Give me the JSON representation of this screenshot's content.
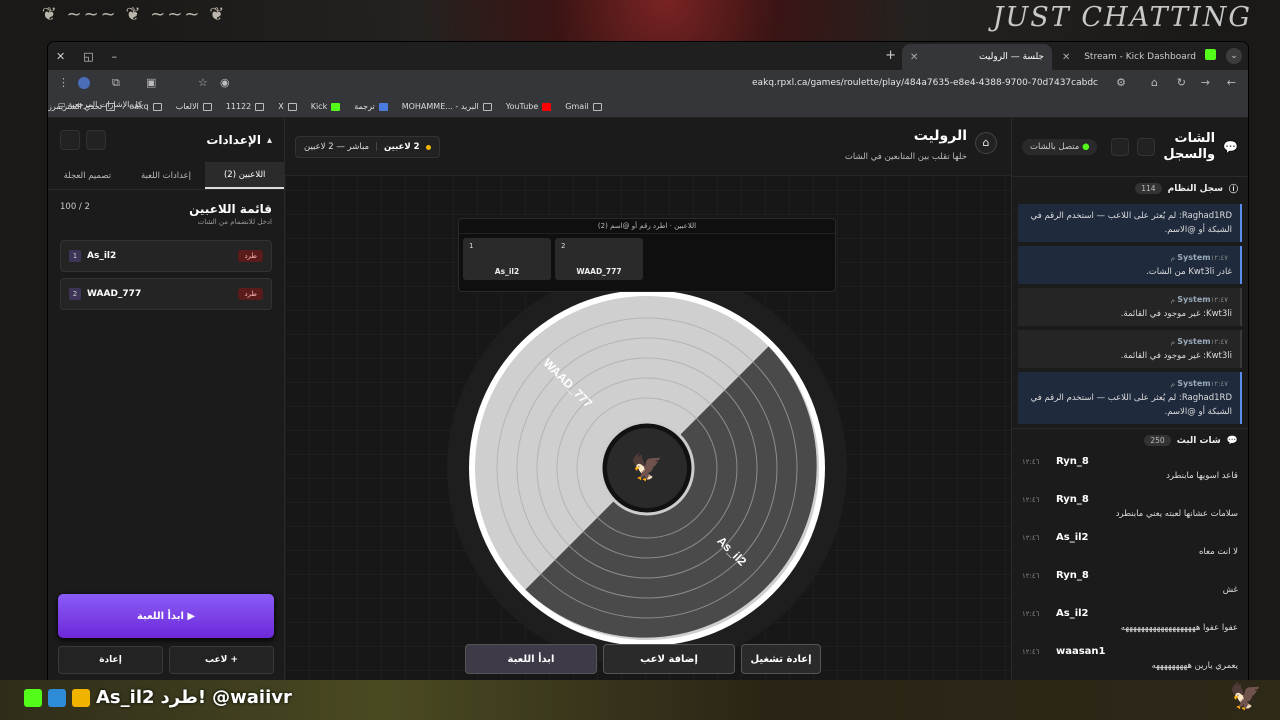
{
  "colors": {
    "accent": "#7c3aed",
    "kick_green": "#53fc18",
    "danger": "#5a1b1b"
  },
  "stream": {
    "brand": "JUST CHATTING",
    "overlay_user": "As_il2",
    "overlay_cmd": "طرد!",
    "overlay_by": "@waiivr"
  },
  "browser": {
    "tabs": [
      {
        "label": "جلسة — الروليت",
        "active": true
      },
      {
        "label": "Stream - Kick Dashboard",
        "active": false
      }
    ],
    "url": "eakq.rpxl.ca/games/roulette/play/484a7635-e8e4-4388-9700-70d7437cabdc",
    "bookmarks": [
      "Gmail",
      "YouTube",
      "البريد - ...MOHAMME",
      "ترجمة",
      "Kick",
      "X",
      "11122",
      "الالعاب",
      "eakq",
      "تحدي الستريمرز"
    ],
    "all_bookmarks": "كل الإشارات المرجعية"
  },
  "settings": {
    "title": "الإعدادات",
    "tabs": [
      "اللاعبين (2)",
      "إعدادات اللعبة",
      "تصميم العجلة"
    ],
    "list_title": "قائمة اللاعبين",
    "list_count": "2 / 100",
    "list_hint": "ادخل للانضمام من الشات",
    "players": [
      {
        "num": "1",
        "name": "As_il2",
        "kick": "طرد"
      },
      {
        "num": "2",
        "name": "WAAD_777",
        "kick": "طرد"
      }
    ],
    "start_label": "▶ ابدأ اللعبة",
    "add_label": "+ لاعب",
    "reset_label": "إعادة"
  },
  "center": {
    "title": "الروليت",
    "subtitle": "خلها تقلب بين المتابعين في الشات",
    "live_count": "2 لاعبين",
    "live_status": "مباشر — 2 لاعبين",
    "picker_hint": "اللاعبين · اطرد رقم أو @اسم (2)",
    "picker_cards": [
      {
        "num": "1",
        "name": "As_il2"
      },
      {
        "num": "2",
        "name": "WAAD_777"
      }
    ],
    "wheel_labels": [
      "WAAD_777",
      "As_il2"
    ],
    "btn_restart": "إعادة تشغيل",
    "btn_add": "إضافة لاعب",
    "btn_start": "ابدأ اللعبة"
  },
  "chat": {
    "title1": "الشات",
    "title2": "والسجل",
    "status": "متصل بالشات",
    "syslog_title": "سجل النظام",
    "syslog_count": "114",
    "sys": [
      {
        "who": "",
        "time": "",
        "text": "Raghad1RD: لم يُعثر على اللاعب — استخدم الرقم في الشبكة أو @الاسم.",
        "blue": true
      },
      {
        "who": "System",
        "time": "١٢:٤٧ م",
        "text": "غادر Kwt3li من الشات.",
        "blue": true
      },
      {
        "who": "System",
        "time": "١٢:٤٧ م",
        "text": "Kwt3li: غير موجود في القائمة.",
        "blue": false
      },
      {
        "who": "System",
        "time": "١٢:٤٧ م",
        "text": "Kwt3li: غير موجود في القائمة.",
        "blue": false
      },
      {
        "who": "System",
        "time": "١٢:٤٧ م",
        "text": "Raghad1RD: لم يُعثر على اللاعب — استخدم الرقم في الشبكة أو @الاسم.",
        "blue": true
      }
    ],
    "chat_title": "شات البث",
    "chat_count": "250",
    "msgs": [
      {
        "user": "Ryn_8",
        "time": "١٢:٤٦",
        "text": "قاعد اسويها مابنطرد"
      },
      {
        "user": "Ryn_8",
        "time": "١٢:٤٦",
        "text": "سلامات عشانها لعبته يعني مابنطرد"
      },
      {
        "user": "As_il2",
        "time": "١٢:٤٦",
        "text": "لا انت معاه"
      },
      {
        "user": "Ryn_8",
        "time": "١٢:٤٦",
        "text": "غش"
      },
      {
        "user": "As_il2",
        "time": "١٢:٤٦",
        "text": "عفوا عفوا هههههههههههههههههههه"
      },
      {
        "user": "waasan1",
        "time": "١٢:٤٦",
        "text": "يعمري يارين هههههههههه"
      }
    ]
  }
}
